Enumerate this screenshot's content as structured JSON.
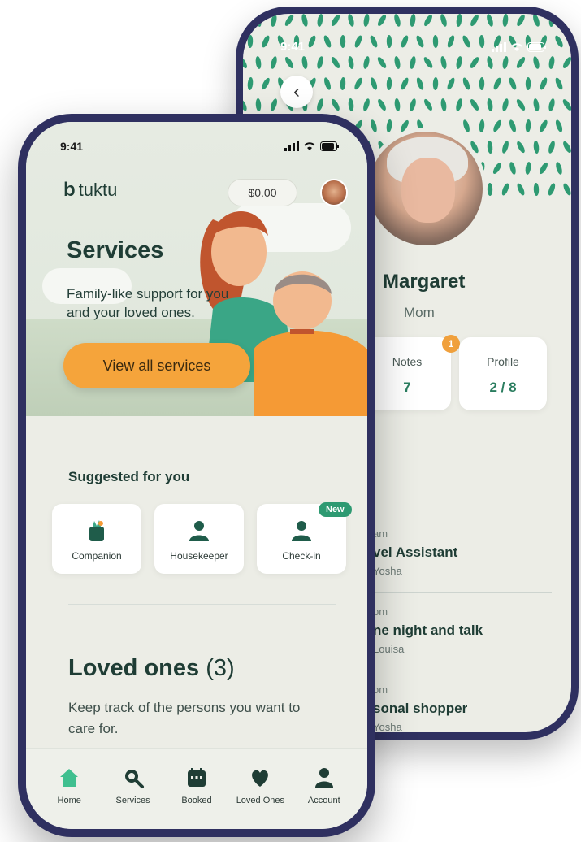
{
  "colors": {
    "brand_green": "#2e9a72",
    "accent_orange": "#f5a43b",
    "dark_green_text": "#1f3d35",
    "phone_frame": "#2f3060"
  },
  "back_screen": {
    "status_time": "9:41",
    "name": "Margaret",
    "role": "Mom",
    "notes": {
      "label": "Notes",
      "value": "7",
      "badge": "1"
    },
    "profile": {
      "label": "Profile",
      "value": "2 / 8"
    },
    "bookings": [
      {
        "time": "am",
        "title": "vel Assistant",
        "who": "Yosha"
      },
      {
        "time": "pm",
        "title": "ne night and talk",
        "who": "Louisa"
      },
      {
        "time": "om",
        "title": "sonal shopper",
        "who": "Yosha"
      }
    ]
  },
  "front_screen": {
    "status_time": "9:41",
    "brand": "tuktu",
    "brand_mark": "b",
    "balance": "$0.00",
    "hero_title": "Services",
    "hero_subtitle": "Family-like support for you and your loved ones.",
    "cta_label": "View all services",
    "suggested_title": "Suggested for you",
    "services": [
      {
        "label": "Companion",
        "icon": "companion-icon"
      },
      {
        "label": "Housekeeper",
        "icon": "person-icon"
      },
      {
        "label": "Check-in",
        "icon": "person-icon"
      }
    ],
    "new_badge": "New",
    "loved_title": "Loved ones",
    "loved_count": "(3)",
    "loved_subtitle": "Keep track of the persons you want to care for.",
    "tabs": [
      {
        "label": "Home",
        "icon": "home-icon",
        "active": true
      },
      {
        "label": "Services",
        "icon": "search-icon"
      },
      {
        "label": "Booked",
        "icon": "calendar-icon"
      },
      {
        "label": "Loved Ones",
        "icon": "heart-icon"
      },
      {
        "label": "Account",
        "icon": "account-icon"
      }
    ]
  }
}
